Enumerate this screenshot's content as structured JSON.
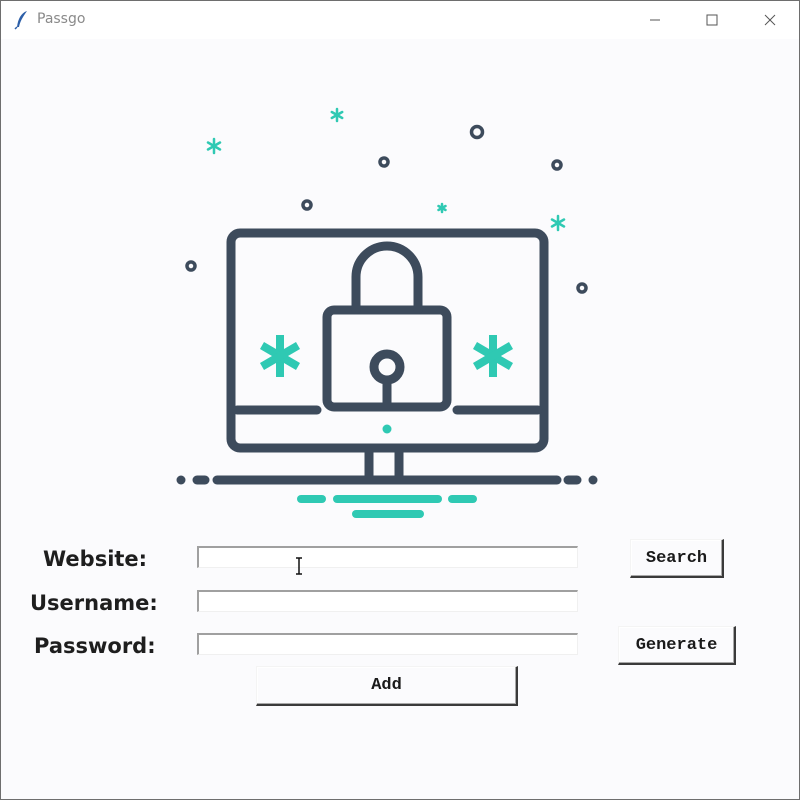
{
  "window": {
    "title": "Passgo",
    "app_icon": "feather-icon",
    "controls": [
      "minimize-icon",
      "maximize-icon",
      "close-icon"
    ]
  },
  "logo": {
    "description_icon": "monitor-padlock-icon",
    "colors": {
      "outline": "#3d4b5c",
      "accent": "#2fc9b3"
    }
  },
  "form": {
    "website": {
      "label": "Website:",
      "value": ""
    },
    "username": {
      "label": "Username:",
      "value": ""
    },
    "password": {
      "label": "Password:",
      "value": ""
    }
  },
  "buttons": {
    "search": "Search",
    "generate": "Generate",
    "add": "Add"
  },
  "colors": {
    "background": "#fbfbfd",
    "text": "#1e1e1e"
  }
}
